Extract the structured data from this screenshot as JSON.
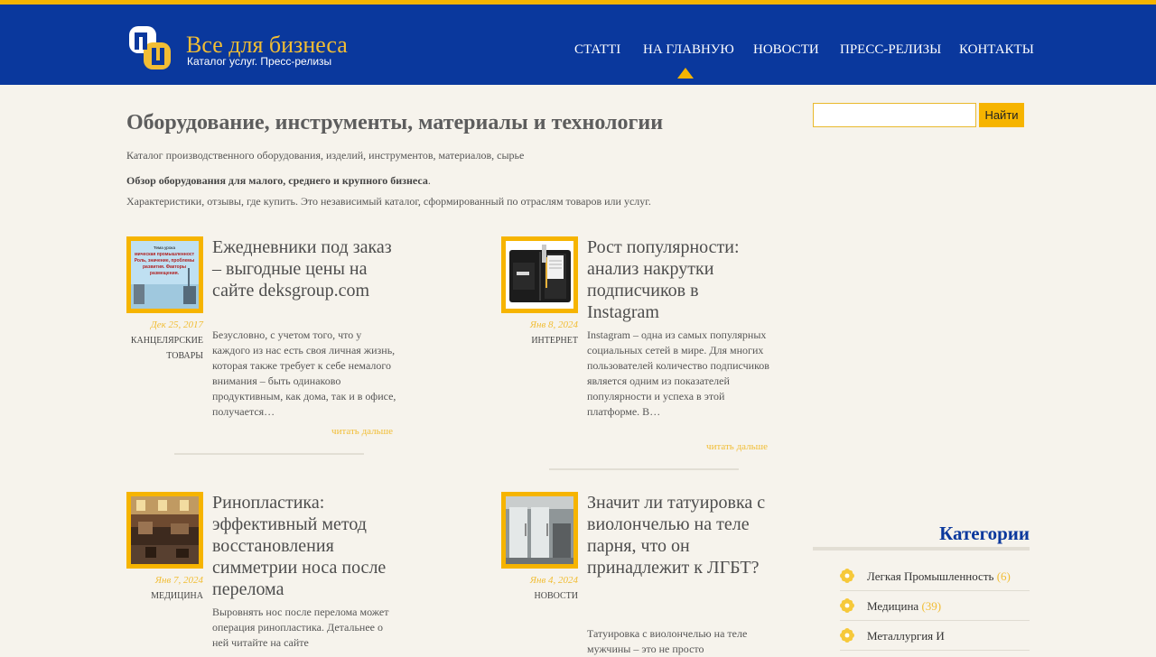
{
  "site": {
    "title": "Все для бизнеса",
    "subtitle": "Каталог услуг. Пресс-релизы"
  },
  "nav": {
    "items": [
      "Статті",
      "На главную",
      "Новости",
      "Пресс-релизы",
      "Контакты"
    ],
    "active": "На главную"
  },
  "search": {
    "value": "",
    "button_label": "Найти"
  },
  "page": {
    "title": "Оборудование, инструменты, материалы и технологии",
    "intro_1": "Каталог производственного оборудования, изделий, инструментов, материалов, сырье",
    "intro_2_bold": "Обзор оборудования для малого, среднего и крупного бизнеса",
    "intro_2_tail": ".",
    "intro_3": "Характеристики, отзывы, где купить. Это независимый каталог, сформированный по отраслям товаров или услуг."
  },
  "posts": [
    {
      "title": "Ежедневники под заказ – выгодные цены на сайте deksgroup.com",
      "date": "Дек 25, 2017",
      "category": "Канцелярские товары",
      "excerpt": "Безусловно, с учетом того, что у каждого из нас есть своя личная жизнь, которая также требует к себе немалого внимания – быть одинаково продуктивным, как дома, так и в офисе, получается…",
      "more": "читать дальше",
      "thumb_text": "Тема урока\nмическая промышленност\nРоль, значение, проблемы\nразвития. Факторы\nразмещения."
    },
    {
      "title": "Рост популярности: анализ накрутки подписчиков в Instagram",
      "date": "Янв 8, 2024",
      "category": "Интернет",
      "excerpt": "Instagram – одна из самых популярных социальных сетей в мире. Для многих пользователей количество подписчиков является одним из показателей популярности и успеха в этой платформе. В…",
      "more": "читать дальше"
    },
    {
      "title": "Ринопластика: эффективный метод восстановления симметрии носа после перелома",
      "date": "Янв 7, 2024",
      "category": "Медицина",
      "excerpt": "Выровнять нос после перелома может операция ринопластика. Детальнее о ней читайте на сайте"
    },
    {
      "title": "Значит ли татуировка с виолончелью на теле парня, что он принадлежит к ЛГБТ?",
      "date": "Янв 4, 2024",
      "category": "Новости",
      "excerpt": "Татуировка с виолончелью на теле мужчины – это не просто"
    }
  ],
  "sidebar": {
    "categories_title": "Категории",
    "categories": [
      {
        "label": "Легкая Промышленность",
        "count": "(6)"
      },
      {
        "label": "Медицина",
        "count": "(39)"
      },
      {
        "label": "Металлургия И",
        "count": ""
      }
    ]
  },
  "colors": {
    "header_bg": "#0a389d",
    "accent": "#f6b400",
    "page_bg": "#f6f3ec"
  }
}
